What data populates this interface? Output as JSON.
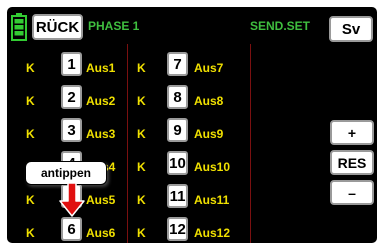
{
  "header": {
    "back_label": "RÜCK",
    "phase_label": "PHASE 1",
    "send_set_label": "SEND.SET",
    "sv_label": "Sv"
  },
  "rows": [
    {
      "left": {
        "type": "K",
        "num": "1",
        "name": "Aus1"
      },
      "right": {
        "type": "K",
        "num": "7",
        "name": "Aus7"
      }
    },
    {
      "left": {
        "type": "K",
        "num": "2",
        "name": "Aus2"
      },
      "right": {
        "type": "K",
        "num": "8",
        "name": "Aus8"
      }
    },
    {
      "left": {
        "type": "K",
        "num": "3",
        "name": "Aus3"
      },
      "right": {
        "type": "K",
        "num": "9",
        "name": "Aus9"
      }
    },
    {
      "left": {
        "type": "K",
        "num": "4",
        "name": "Aus4"
      },
      "right": {
        "type": "K",
        "num": "10",
        "name": "Aus10"
      }
    },
    {
      "left": {
        "type": "K",
        "num": "5",
        "name": "Aus5"
      },
      "right": {
        "type": "K",
        "num": "11",
        "name": "Aus11"
      }
    },
    {
      "left": {
        "type": "K",
        "num": "6",
        "name": "Aus6"
      },
      "right": {
        "type": "K",
        "num": "12",
        "name": "Aus12"
      }
    }
  ],
  "side_buttons": {
    "plus_label": "+",
    "res_label": "RES",
    "minus_label": "–"
  },
  "callout": {
    "text": "antippen",
    "arrow_color": "#e01010"
  },
  "colors": {
    "background": "#000000",
    "text_yellow": "#f0e000",
    "header_green": "#3fbf3f",
    "battery_green": "#33cc33"
  },
  "icons": {
    "battery": "battery-icon"
  }
}
